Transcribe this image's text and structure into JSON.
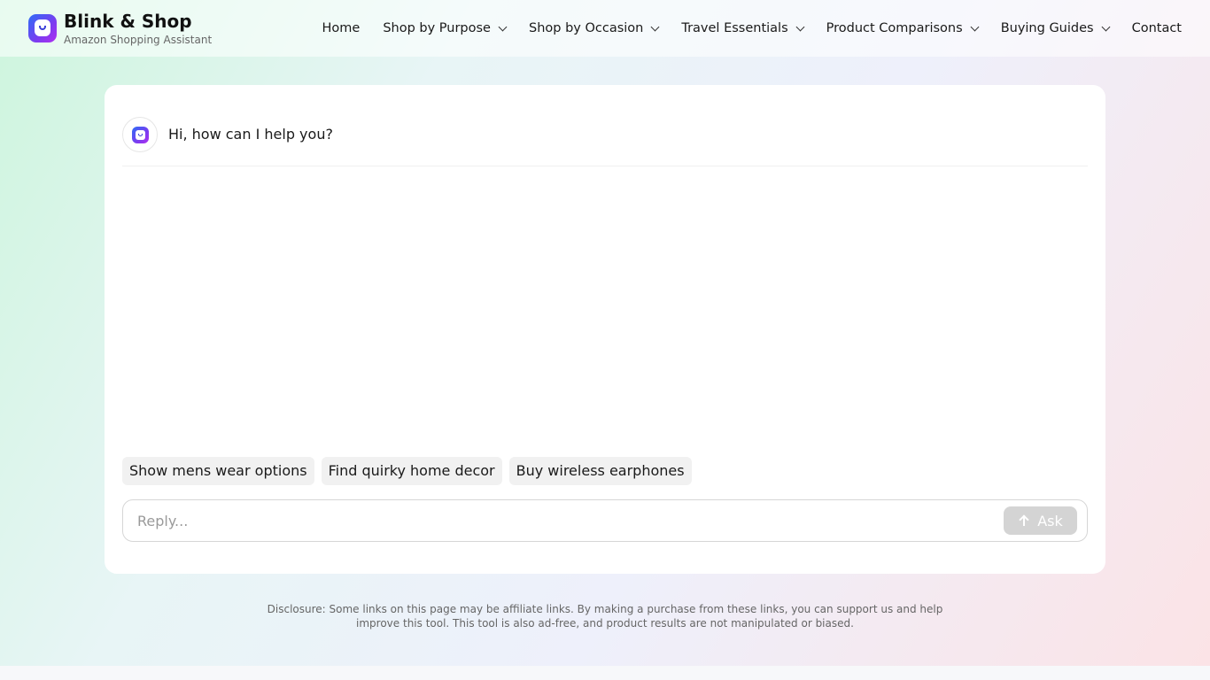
{
  "brand": {
    "title": "Blink & Shop",
    "subtitle": "Amazon Shopping Assistant"
  },
  "nav": {
    "items": [
      {
        "label": "Home",
        "has_dropdown": false
      },
      {
        "label": "Shop by Purpose",
        "has_dropdown": true
      },
      {
        "label": "Shop by Occasion",
        "has_dropdown": true
      },
      {
        "label": "Travel Essentials",
        "has_dropdown": true
      },
      {
        "label": "Product Comparisons",
        "has_dropdown": true
      },
      {
        "label": "Buying Guides",
        "has_dropdown": true
      },
      {
        "label": "Contact",
        "has_dropdown": false
      }
    ]
  },
  "chat": {
    "greeting": "Hi, how can I help you?",
    "suggestions": [
      "Show mens wear options",
      "Find quirky home decor",
      "Buy wireless earphones"
    ],
    "input": {
      "value": "",
      "placeholder": "Reply..."
    },
    "ask_label": "Ask"
  },
  "footer": {
    "disclosure": "Disclosure: Some links on this page may be affiliate links. By making a purchase from these links, you can support us and help improve this tool. This tool is also ad-free, and product results are not manipulated or biased."
  },
  "colors": {
    "ask_button_disabled": "#d4d4d4",
    "chip_bg": "#f1f1f1",
    "logo_gradient": [
      "#2d6df6",
      "#7b3cf0",
      "#b02ef0"
    ]
  },
  "icons": {
    "logo": "shopping-bag-smile-icon",
    "nav_dropdown": "chevron-down-icon",
    "ask": "arrow-up-icon"
  }
}
